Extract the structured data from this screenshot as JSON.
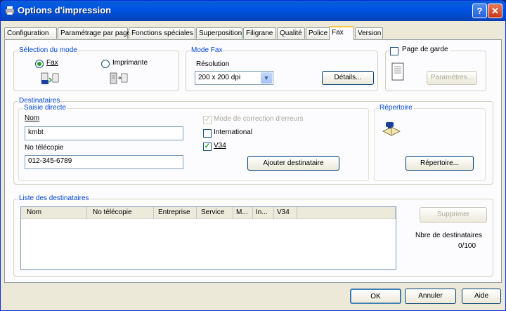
{
  "window": {
    "title": "Options d'impression",
    "help_label": "?",
    "close_label": "✕"
  },
  "tabs": [
    {
      "label": "Configuration"
    },
    {
      "label": "Paramétrage par page"
    },
    {
      "label": "Fonctions spéciales"
    },
    {
      "label": "Superposition"
    },
    {
      "label": "Filigrane"
    },
    {
      "label": "Qualité"
    },
    {
      "label": "Police"
    },
    {
      "label": "Fax"
    },
    {
      "label": "Version"
    }
  ],
  "mode": {
    "legend": "Sélection du mode",
    "fax_label": "Fax",
    "printer_label": "Imprimante",
    "selected": "Fax"
  },
  "fax_mode": {
    "legend": "Mode Fax",
    "resolution_label": "Résolution",
    "resolution_value": "200 x 200 dpi",
    "details_label": "Détails..."
  },
  "cover": {
    "label": "Page de garde",
    "checked": false,
    "params_label": "Paramètres..."
  },
  "recipients": {
    "legend": "Destinataires",
    "direct_legend": "Saisie directe",
    "name_label": "Nom",
    "name_value": "kmbt",
    "fax_label": "No télécopie",
    "fax_value": "012-345-6789",
    "ecm_label": "Mode de correction d'erreurs",
    "international_label": "International",
    "v34_label": "V34",
    "add_label": "Ajouter destinataire",
    "directory_legend": "Répertoire",
    "directory_button": "Répertoire..."
  },
  "recipient_list": {
    "legend": "Liste des destinataires",
    "columns": [
      "Nom",
      "No télécopie",
      "Entreprise",
      "Service",
      "M...",
      "In...",
      "V34"
    ],
    "delete_label": "Supprimer",
    "count_label": "Nbre de destinataires",
    "count_value": "0/100"
  },
  "footer": {
    "ok": "OK",
    "cancel": "Annuler",
    "help": "Aide"
  }
}
